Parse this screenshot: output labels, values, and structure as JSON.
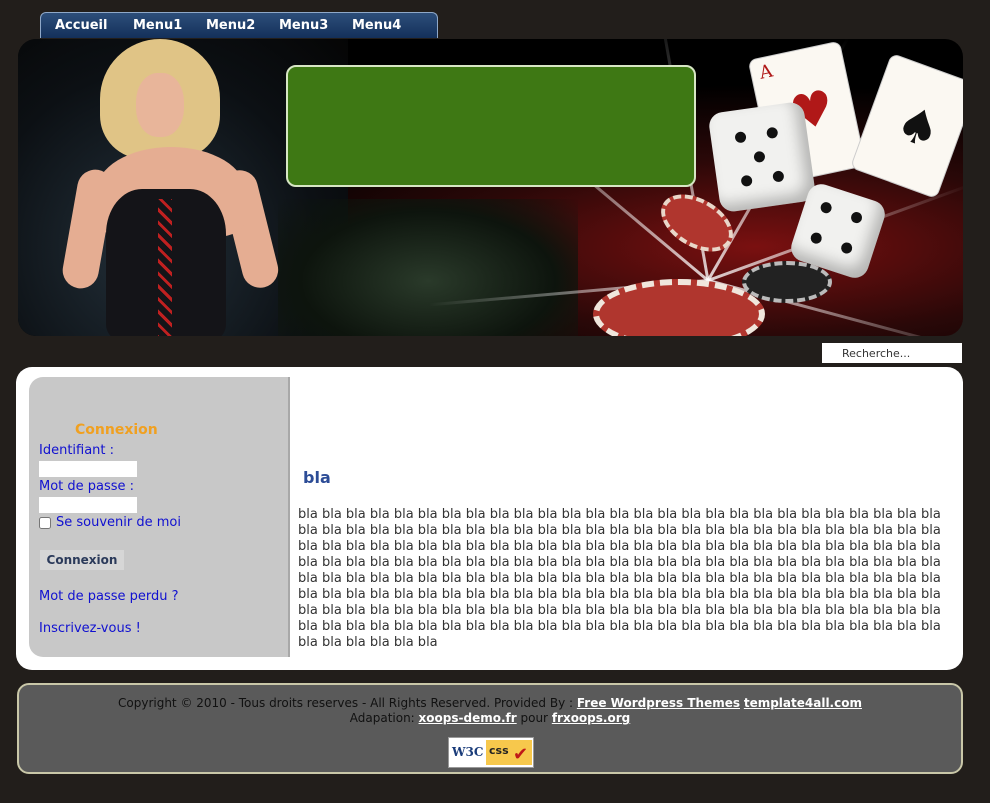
{
  "nav": {
    "items": [
      "Accueil",
      "Menu1",
      "Menu2",
      "Menu3",
      "Menu4"
    ]
  },
  "search": {
    "value": "Recherche..."
  },
  "login": {
    "title": "Connexion",
    "identifier_label": "Identifiant :",
    "password_label": "Mot de passe :",
    "remember_label": "Se souvenir de moi",
    "submit_label": "Connexion",
    "lost_password_link": "Mot de passe perdu ?",
    "register_link": "Inscrivez-vous !"
  },
  "article": {
    "title": "bla",
    "body": "bla bla bla bla bla bla bla bla bla bla bla bla bla bla bla bla bla bla bla bla bla bla bla bla bla bla bla bla bla bla bla bla bla bla bla bla bla bla bla bla bla bla bla bla bla bla bla bla bla bla bla bla bla bla bla bla bla bla bla bla bla bla bla bla bla bla bla bla bla bla bla bla bla bla bla bla bla bla bla bla bla bla bla bla bla bla bla bla bla bla bla bla bla bla bla bla bla bla bla bla bla bla bla bla bla bla bla bla bla bla bla bla bla bla bla bla bla bla bla bla bla bla bla bla bla bla bla bla bla bla bla bla bla bla bla bla bla bla bla bla bla bla bla bla bla bla bla bla bla bla bla bla bla bla bla bla bla bla bla bla bla bla bla bla bla bla bla bla bla bla bla bla bla bla bla bla bla bla bla bla bla bla bla bla bla bla bla bla bla bla bla bla bla bla bla bla bla bla bla bla bla bla bla bla bla bla bla bla bla bla bla bla bla bla bla bla bla bla bla bla bla bla"
  },
  "footer": {
    "line1_prefix": "Copyright © 2010 - Tous droits reserves - All Rights Reserved. Provided By : ",
    "link_themes": "Free Wordpress Themes",
    "sep": " ",
    "link_template": "template4all.com",
    "line2_prefix": "Adapation: ",
    "link_xoops": "xoops-demo.fr",
    "line2_mid": " pour ",
    "link_frxoops": "frxoops.org",
    "badge_w3c": "W3C",
    "badge_css": "css"
  },
  "colors": {
    "background": "#221e1b",
    "nav": "#14305a",
    "green_box": "#3e7814",
    "sidebar": "#c8c8c8",
    "login_title": "#f0a020",
    "link": "#1010d0",
    "article_title": "#2c4c96",
    "footer": "#5a5a5a"
  }
}
